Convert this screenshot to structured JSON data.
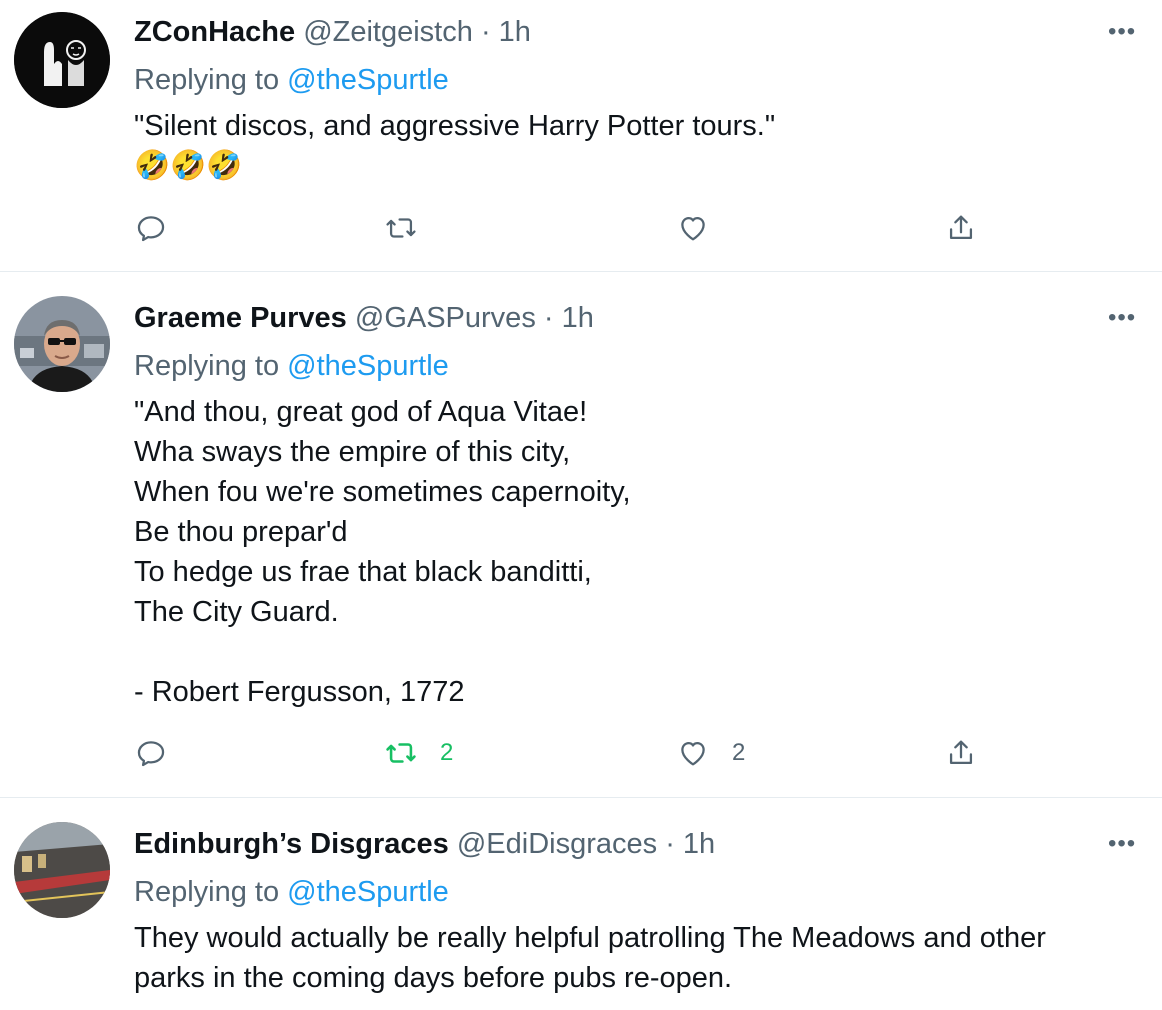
{
  "tweets": [
    {
      "name": "ZConHache",
      "handle": "@Zeitgeistch",
      "dot": "·",
      "time": "1h",
      "replying_prefix": "Replying to",
      "replying_to": "@theSpurtle",
      "lines": [
        "\"Silent discos, and aggressive Harry Potter tours.\"",
        "🤣🤣🤣"
      ],
      "actions": {
        "reply": "",
        "retweet": "",
        "like": "",
        "share": ""
      }
    },
    {
      "name": "Graeme Purves",
      "handle": "@GASPurves",
      "dot": "·",
      "time": "1h",
      "replying_prefix": "Replying to",
      "replying_to": "@theSpurtle",
      "lines": [
        "\"And thou, great god of Aqua Vitae!",
        "Wha sways the empire of this city,",
        "When fou we're sometimes capernoity,",
        "Be thou prepar'd",
        "To hedge us frae that black banditti,",
        "The City Guard.",
        "",
        "- Robert Fergusson, 1772"
      ],
      "actions": {
        "reply": "",
        "retweet": "2",
        "like": "2",
        "share": ""
      }
    },
    {
      "name": "Edinburgh’s Disgraces",
      "handle": "@EdiDisgraces",
      "dot": "·",
      "time": "1h",
      "replying_prefix": "Replying to",
      "replying_to": "@theSpurtle",
      "lines": [
        "They would actually be really helpful patrolling The Meadows and other",
        "parks in the coming days before pubs re-open."
      ]
    }
  ],
  "icons": {
    "more": "more-icon",
    "reply": "reply-icon",
    "retweet": "retweet-icon",
    "like": "like-icon",
    "share": "share-icon"
  },
  "colors": {
    "text": "#0f1419",
    "secondary": "#536471",
    "mention": "#1d9bf0",
    "retweet_active": "#17bf63",
    "divider": "#e6ecf0"
  },
  "more_glyph": "•••"
}
